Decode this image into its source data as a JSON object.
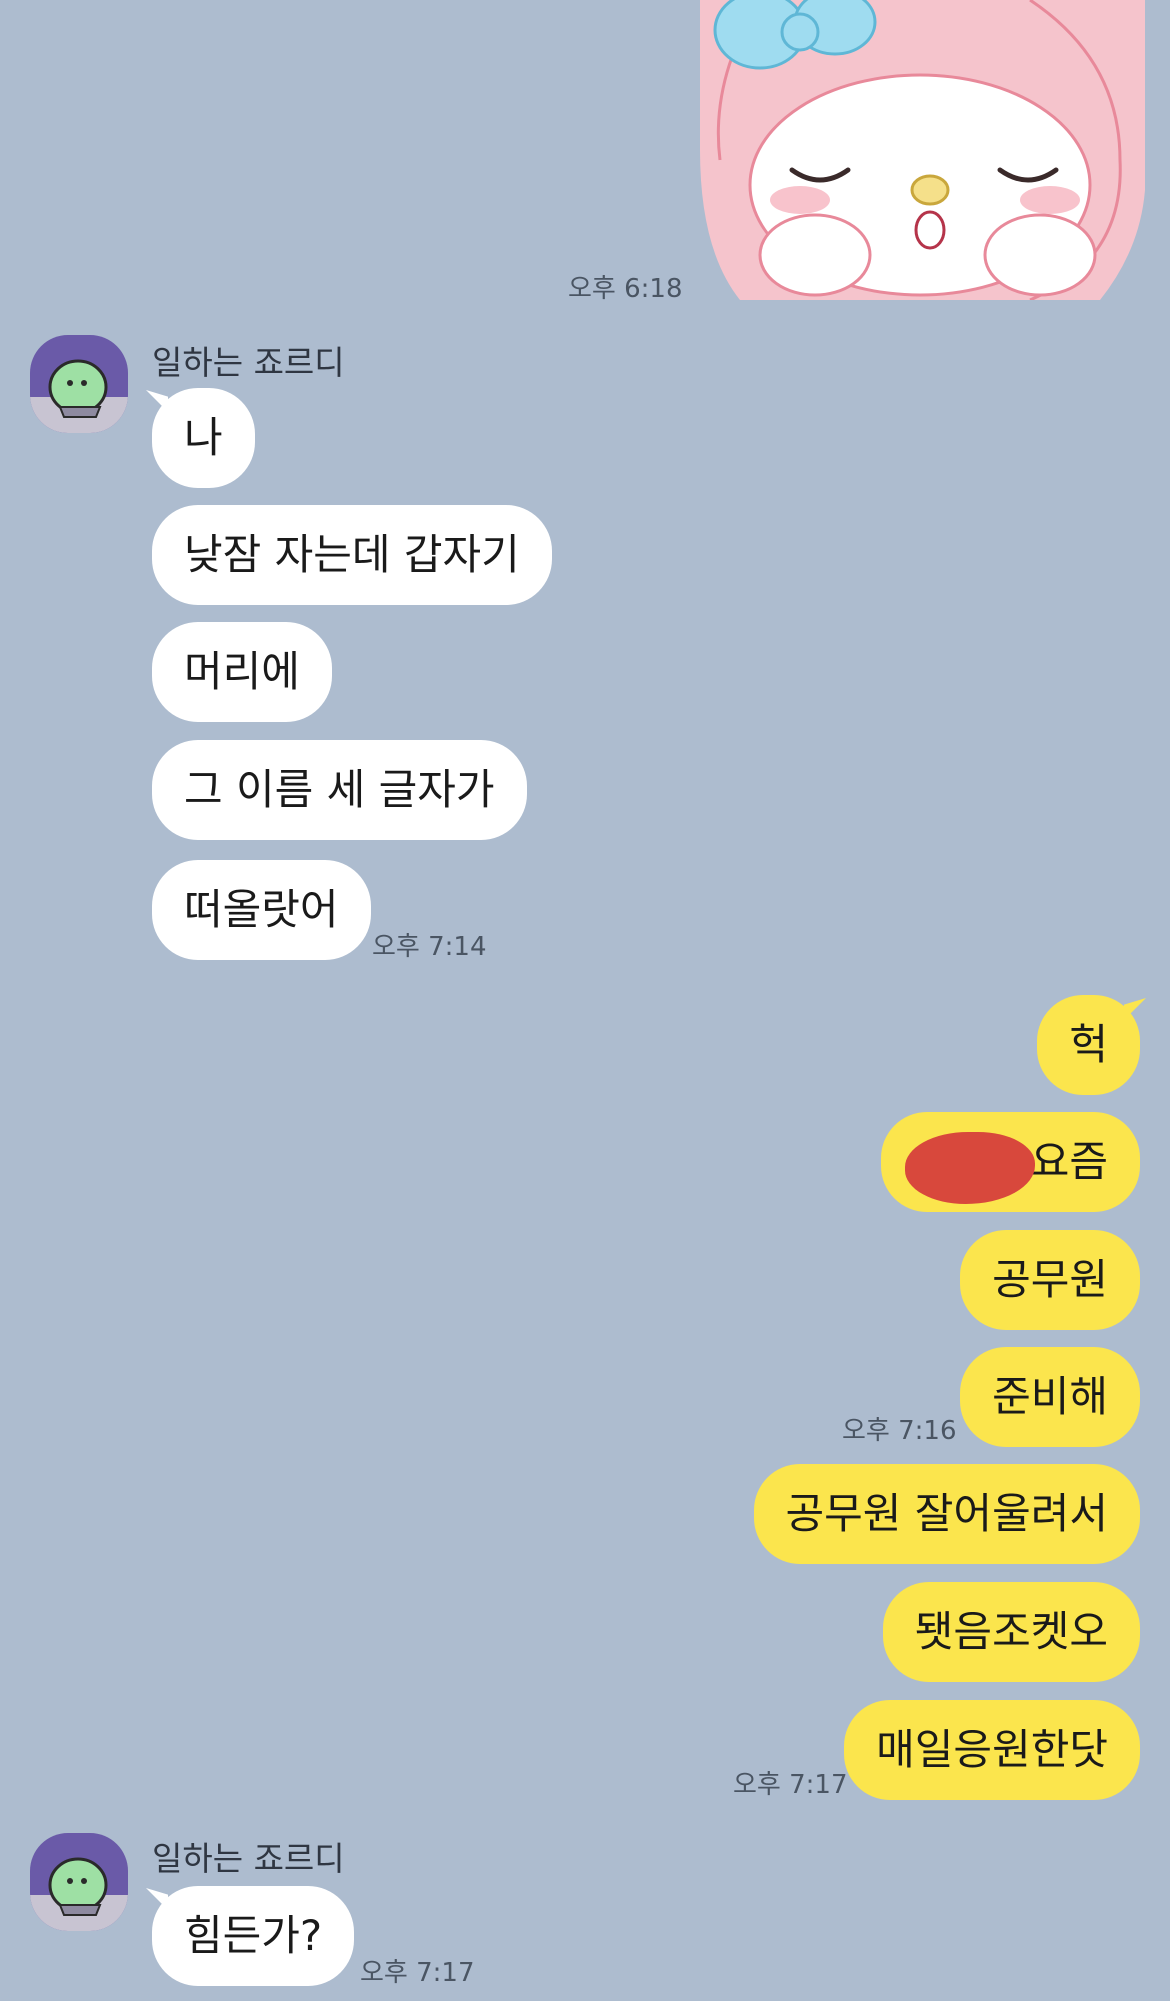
{
  "colors": {
    "background": "#adbccf",
    "incoming_bubble": "#ffffff",
    "outgoing_bubble": "#fbe54d",
    "redaction": "#d8483c",
    "avatar_bg": "#6a5aa8"
  },
  "sticker": {
    "icon": "my-melody-sticker-icon"
  },
  "chat": {
    "sticker_time": "오후 6:18",
    "group1": {
      "sender": "일하는 죠르디",
      "avatar_icon": "jordy-avatar-icon",
      "messages": [
        "나",
        "낮잠 자는데 갑자기",
        "머리에",
        "그 이름 세 글자가",
        "떠올랏어"
      ],
      "time": "오후 7:14"
    },
    "group2": {
      "messages": [
        "헉",
        "요즘",
        "공무원",
        "준비해"
      ],
      "time": "오후 7:16",
      "redaction_icon": "red-scribble-redaction-icon"
    },
    "group3": {
      "messages": [
        "공무원 잘어울려서",
        "됏음조켓오",
        "매일응원한닷"
      ],
      "time": "오후 7:17"
    },
    "group4": {
      "sender": "일하는 죠르디",
      "avatar_icon": "jordy-avatar-icon",
      "messages": [
        "힘든가?"
      ],
      "time": "오후 7:17"
    }
  }
}
